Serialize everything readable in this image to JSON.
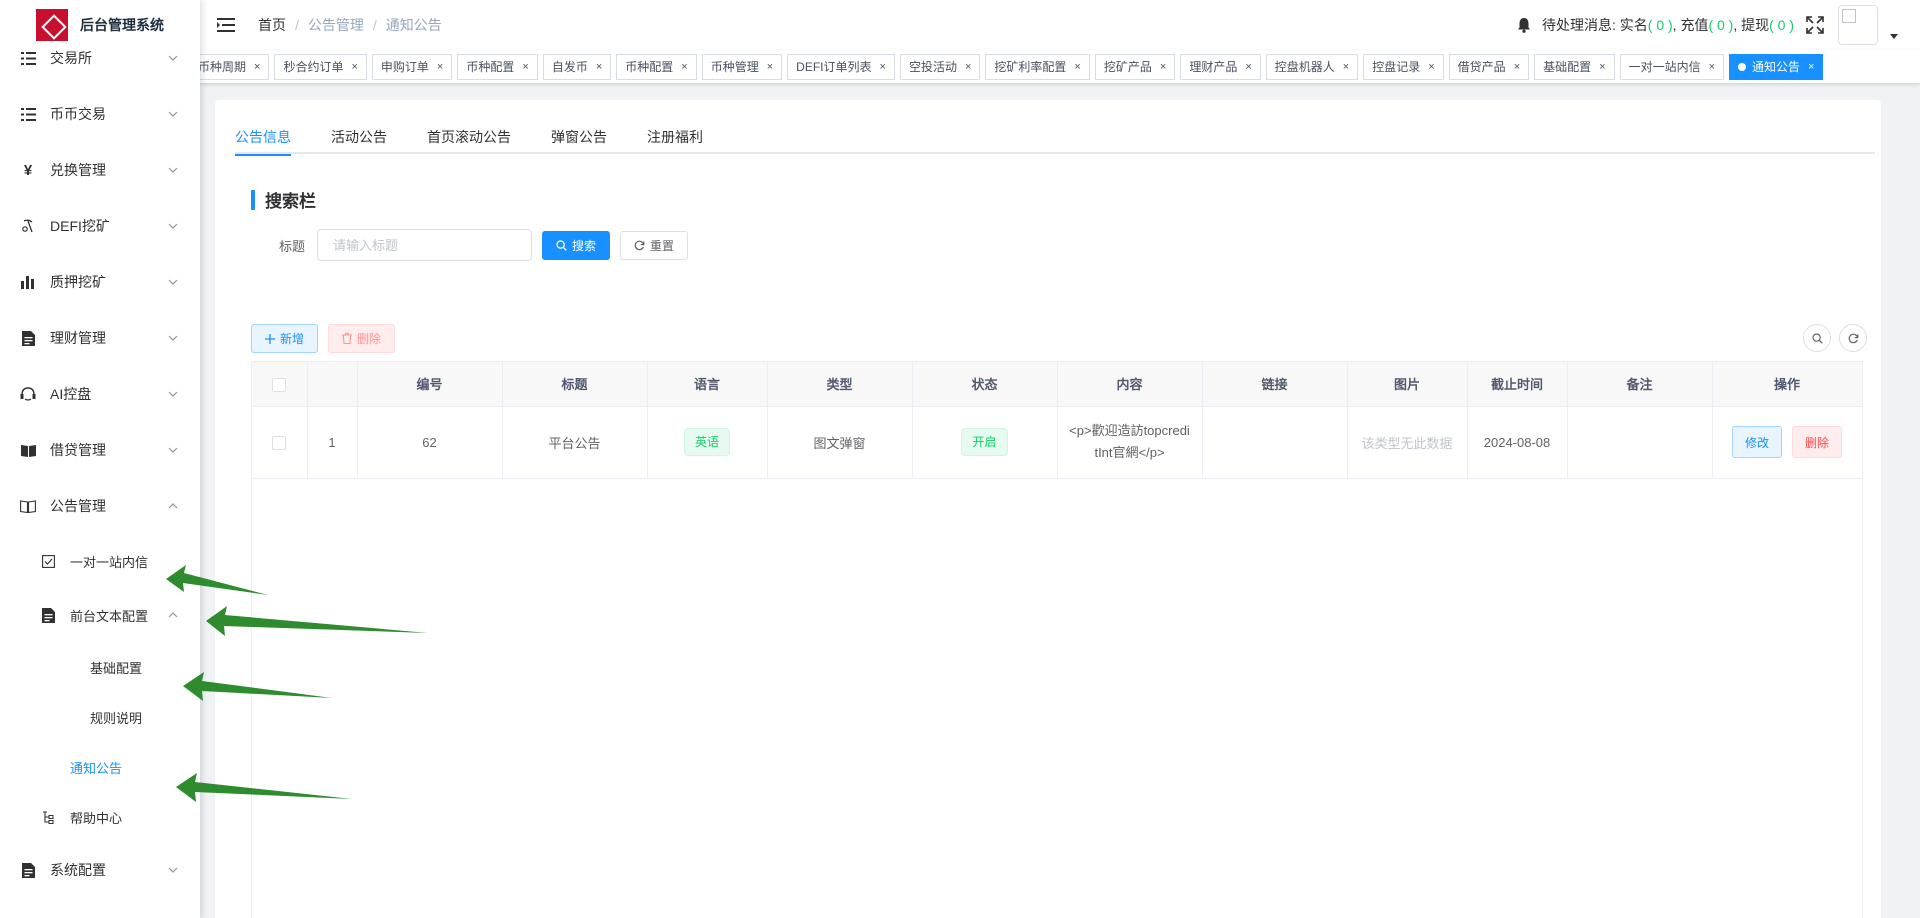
{
  "app": {
    "title": "后台管理系统"
  },
  "sidebar": {
    "items": [
      {
        "label": "交易所",
        "icon": "list-icon"
      },
      {
        "label": "币币交易",
        "icon": "list-icon"
      },
      {
        "label": "兑换管理",
        "icon": "yen-icon"
      },
      {
        "label": "DEFI挖矿",
        "icon": "pickaxe-icon"
      },
      {
        "label": "质押挖矿",
        "icon": "bar-chart-icon"
      },
      {
        "label": "理财管理",
        "icon": "document-icon"
      },
      {
        "label": "AI控盘",
        "icon": "robot-icon"
      },
      {
        "label": "借贷管理",
        "icon": "book-icon"
      },
      {
        "label": "公告管理",
        "icon": "open-book-icon"
      }
    ],
    "announcement_sub": {
      "internal_message": "一对一站内信",
      "frontend_text": "前台文本配置",
      "basic_config": "基础配置",
      "rules": "规则说明",
      "notice": "通知公告",
      "help_center": "帮助中心"
    },
    "system_config": "系统配置"
  },
  "navbar": {
    "breadcrumb": [
      "首页",
      "公告管理",
      "通知公告"
    ],
    "pending_label": "待处理消息:",
    "realname_label": "实名",
    "realname_count": "( 0 )",
    "recharge_label": "充值",
    "recharge_count": "( 0 )",
    "withdraw_label": "提现",
    "withdraw_count": "( 0 )",
    "sep": ","
  },
  "tags": [
    {
      "label": "币种周期"
    },
    {
      "label": "秒合约订单"
    },
    {
      "label": "申购订单"
    },
    {
      "label": "币种配置"
    },
    {
      "label": "自发币"
    },
    {
      "label": "币种配置"
    },
    {
      "label": "币种管理"
    },
    {
      "label": "DEFI订单列表"
    },
    {
      "label": "空投活动"
    },
    {
      "label": "挖矿利率配置"
    },
    {
      "label": "挖矿产品"
    },
    {
      "label": "理财产品"
    },
    {
      "label": "控盘机器人"
    },
    {
      "label": "控盘记录"
    },
    {
      "label": "借贷产品"
    },
    {
      "label": "基础配置"
    },
    {
      "label": "一对一站内信"
    },
    {
      "label": "通知公告",
      "active": true
    }
  ],
  "tabs": [
    "公告信息",
    "活动公告",
    "首页滚动公告",
    "弹窗公告",
    "注册福利"
  ],
  "search": {
    "section_title": "搜索栏",
    "title_label": "标题",
    "title_placeholder": "请输入标题",
    "search_button": "搜索",
    "reset_button": "重置"
  },
  "toolbar": {
    "add": "新增",
    "delete": "删除"
  },
  "table": {
    "headers": [
      "",
      "",
      "编号",
      "标题",
      "语言",
      "类型",
      "状态",
      "内容",
      "链接",
      "图片",
      "截止时间",
      "备注",
      "操作"
    ],
    "rows": [
      {
        "index": "1",
        "id": "62",
        "title": "平台公告",
        "language": "英语",
        "type": "图文弹窗",
        "status": "开启",
        "content": "<p>歡迎造訪topcreditInt官網</p>",
        "link": "",
        "image": "该类型无此数据",
        "deadline": "2024-08-08",
        "remark": "",
        "edit": "修改",
        "delete": "删除"
      }
    ]
  },
  "colors": {
    "accent": "#1890ff",
    "success": "#13ce66",
    "danger": "#ff4949",
    "logo": "#c8102e",
    "arrow": "#2e8b2e"
  }
}
